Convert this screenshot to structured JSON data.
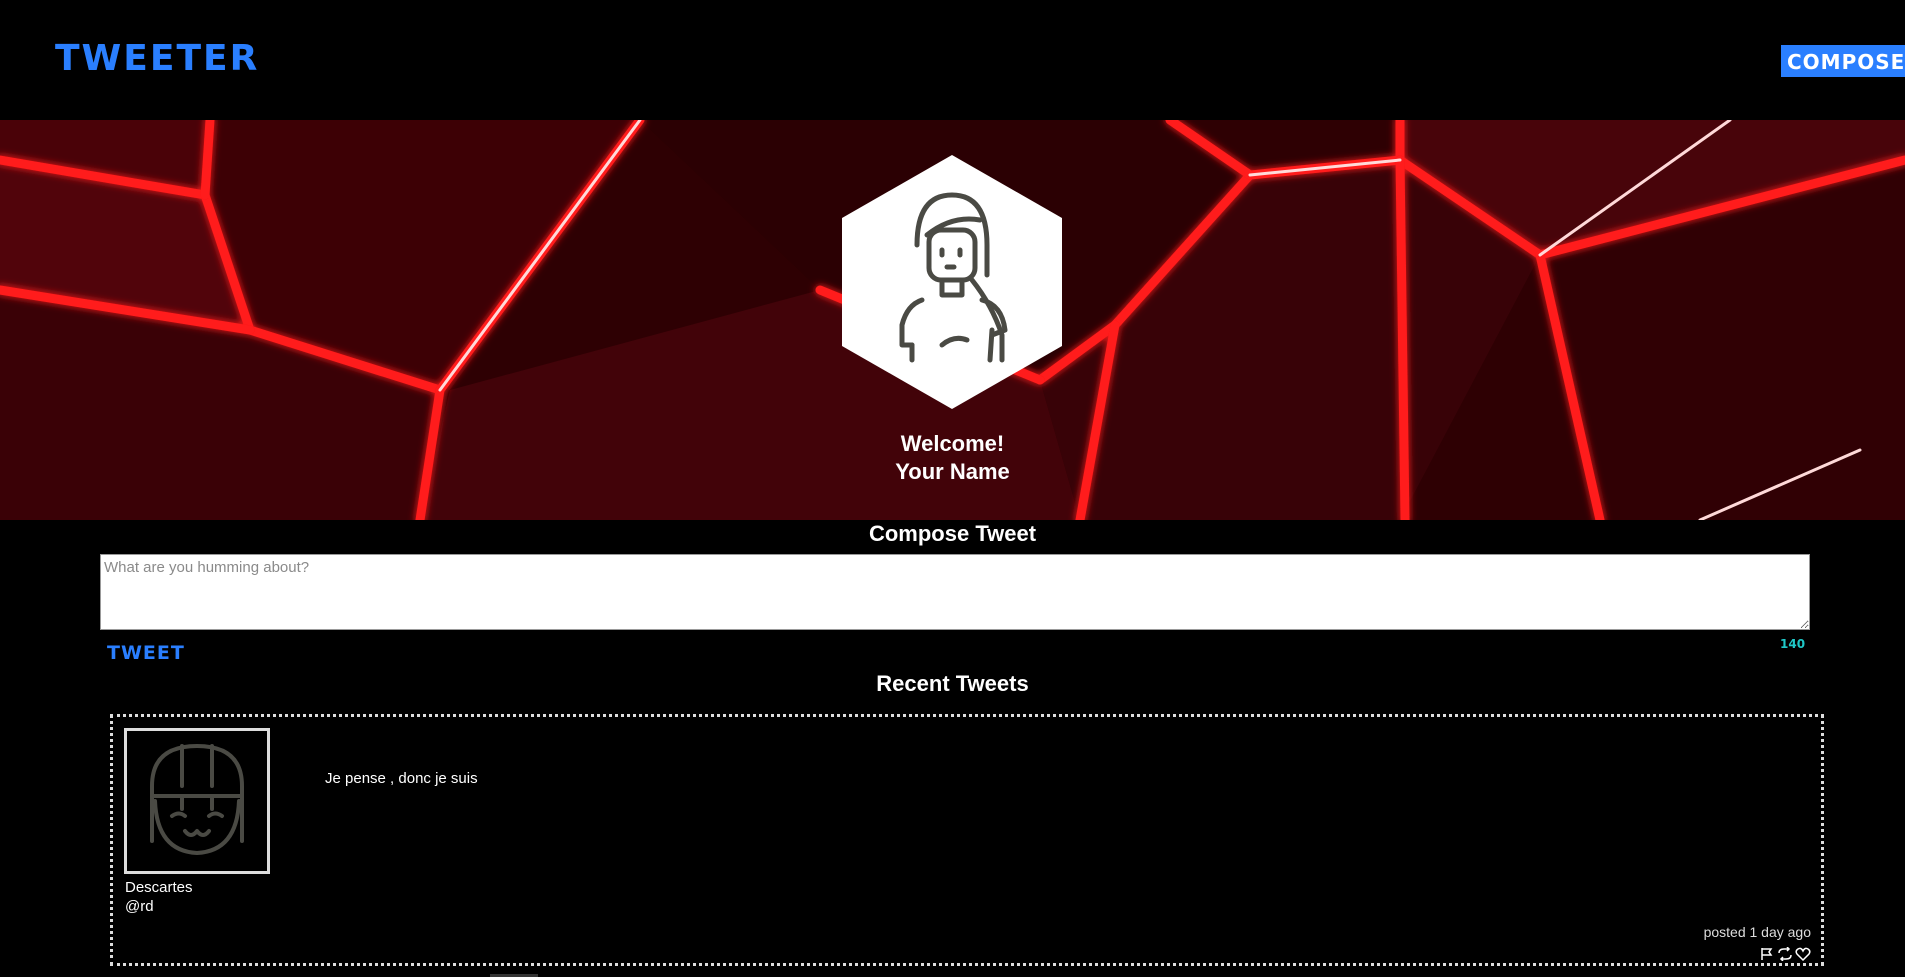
{
  "nav": {
    "brand": "TWEETER",
    "compose_label": "COMPOSE"
  },
  "hero": {
    "welcome": "Welcome!",
    "name": "Your Name",
    "avatar_icon": "user-avatar-icon"
  },
  "compose": {
    "title": "Compose Tweet",
    "placeholder": "What are you humming about?",
    "value": "",
    "tweet_label": "TWEET",
    "counter": "140"
  },
  "recent": {
    "title": "Recent Tweets",
    "tweets": [
      {
        "name": "Descartes",
        "handle": "@rd",
        "text": "Je pense , donc je suis",
        "date": "posted 1 day ago",
        "actions": [
          "flag-icon",
          "retweet-icon",
          "like-icon"
        ]
      }
    ]
  },
  "colors": {
    "accent": "#2a7fff",
    "counter": "#1fc7c7",
    "background": "#000000",
    "hero_red": "#ff1a1a"
  }
}
